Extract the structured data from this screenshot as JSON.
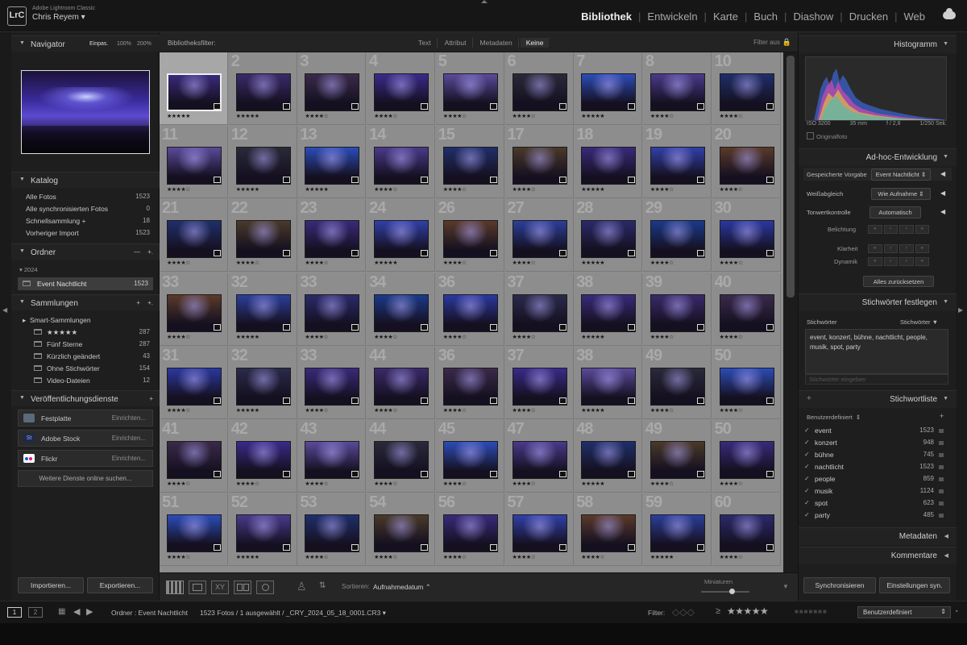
{
  "app": {
    "subtitle": "Adobe Lightroom Classic",
    "user": "Chris Reyem",
    "logo": "LrC"
  },
  "modules": [
    "Bibliothek",
    "Entwickeln",
    "Karte",
    "Buch",
    "Diashow",
    "Drucken",
    "Web"
  ],
  "active_module": "Bibliothek",
  "navigator": {
    "title": "Navigator",
    "zoom": [
      "Einpas.",
      "100%",
      "200%"
    ]
  },
  "catalog": {
    "title": "Katalog",
    "items": [
      {
        "label": "Alle Fotos",
        "count": "1523"
      },
      {
        "label": "Alle synchronisierten Fotos",
        "count": "0"
      },
      {
        "label": "Schnellsammlung +",
        "count": "18"
      },
      {
        "label": "Vorheriger Import",
        "count": "1523"
      }
    ]
  },
  "folders": {
    "title": "Ordner",
    "year": "2024",
    "folder": {
      "label": "Event Nachtlicht",
      "count": "1523"
    }
  },
  "collections": {
    "title": "Sammlungen",
    "group": "Smart-Sammlungen",
    "items": [
      {
        "label": "★★★★★",
        "count": "287"
      },
      {
        "label": "Fünf Sterne",
        "count": "287"
      },
      {
        "label": "Kürzlich geändert",
        "count": "43"
      },
      {
        "label": "Ohne Stichwörter",
        "count": "154"
      },
      {
        "label": "Video-Dateien",
        "count": "12"
      }
    ]
  },
  "publish": {
    "title": "Veröffentlichungsdienste",
    "services": [
      {
        "label": "Festplatte",
        "action": "Einrichten...",
        "color": "#5a6a7a"
      },
      {
        "label": "Adobe Stock",
        "action": "Einrichten...",
        "color": "#1e2a4a"
      },
      {
        "label": "Flickr",
        "action": "Einrichten...",
        "color": "#ffffff"
      }
    ],
    "more": "Weitere Dienste online suchen..."
  },
  "left_buttons": {
    "import": "Importieren...",
    "export": "Exportieren..."
  },
  "filterbar": {
    "label": "Bibliotheksfilter:",
    "tabs": [
      "Text",
      "Attribut",
      "Metadaten",
      "Keine"
    ],
    "active": "Keine",
    "filter_off": "Filter aus"
  },
  "grid": {
    "numbers": [
      "1",
      "2",
      "3",
      "4",
      "5",
      "6",
      "7",
      "8",
      "10",
      "11",
      "12",
      "13",
      "14",
      "15",
      "17",
      "18",
      "19",
      "20",
      "21",
      "22",
      "23",
      "24",
      "26",
      "27",
      "28",
      "29",
      "30",
      "33",
      "32",
      "33",
      "34",
      "36",
      "37",
      "38",
      "39",
      "40",
      "31",
      "32",
      "33",
      "44",
      "36",
      "37",
      "38",
      "49",
      "50",
      "41",
      "42",
      "43",
      "44",
      "45",
      "47",
      "48",
      "49",
      "50",
      "51",
      "52",
      "53",
      "54",
      "56",
      "57",
      "58",
      "59",
      "60"
    ],
    "ratings": [
      "★★★★★",
      "★★★★★",
      "★★★★☆",
      "★★★★☆",
      "★★★★☆",
      "★★★★☆",
      "★★★★★",
      "★★★★☆",
      "★★★★☆",
      "★★★★☆",
      "★★★★★",
      "★★★★★",
      "★★★★☆",
      "★★★★☆",
      "★★★★☆",
      "★★★★★",
      "★★★★☆",
      "★★★★☆",
      "★★★★☆",
      "★★★★☆",
      "★★★★☆",
      "★★★★★",
      "★★★★☆",
      "★★★★☆",
      "★★★★★",
      "★★★★☆",
      "★★★★☆",
      "★★★★☆",
      "★★★★★",
      "★★★★☆",
      "★★★★☆",
      "★★★★☆",
      "★★★★☆",
      "★★★★★",
      "★★★★☆",
      "★★★★☆",
      "★★★★☆",
      "★★★★★",
      "★★★★☆",
      "★★★★☆",
      "★★★★☆",
      "★★★★☆",
      "★★★★★",
      "★★★★☆",
      "★★★★☆",
      "★★★★☆",
      "★★★★☆",
      "★★★★☆",
      "★★★★☆",
      "★★★★☆",
      "★★★★☆",
      "★★★★★",
      "★★★★☆",
      "★★★★☆",
      "★★★★☆",
      "★★★★★",
      "★★★★☆",
      "★★★★☆",
      "★★★★☆",
      "★★★★☆",
      "★★★★☆",
      "★★★★★",
      "★★★★☆"
    ],
    "photo_colors": [
      "#3a2a7a",
      "#2b3f9a",
      "#1f2f6a",
      "#3a2a8a",
      "#2a38a0",
      "#3040a8",
      "#2b4cb8",
      "#3a2a6a",
      "#2a2a6a",
      "#4a3a2a",
      "#5a4a9a",
      "#2a2a4a",
      "#5a3a2a",
      "#4a3a8a",
      "#3a2a4a",
      "#1a3a8a",
      "#3a2a7a",
      "#2a2a3a"
    ],
    "selected_index": 0
  },
  "toolbar": {
    "sort_label": "Sortieren:",
    "sort_value": "Aufnahmedatum",
    "thumb_label": "Miniaturen"
  },
  "histogram": {
    "title": "Histogramm",
    "iso": "ISO 3200",
    "focal": "35 mm",
    "aperture": "f / 2,8",
    "shutter": "1/250 Sek.",
    "original": "Originalfoto"
  },
  "quick_develop": {
    "title": "Ad-hoc-Entwicklung",
    "preset_label": "Gespeicherte Vorgabe",
    "preset_value": "Event Nachtlicht",
    "wb_label": "Weißabgleich",
    "wb_value": "Wie Aufnahme",
    "tone_label": "Tonwertkontrolle",
    "tone_value": "Automatisch",
    "exposure": "Belichtung",
    "clarity": "Klarheit",
    "vibrance": "Dynamik",
    "reset": "Alles zurücksetzen"
  },
  "keywording": {
    "title": "Stichwörter festlegen",
    "label": "Stichwörter",
    "dropdown": "Stichwörter",
    "tags": "event, konzert, bühne, nachtlicht, people, musik, spot, party",
    "placeholder": "Stichwörter eingeben"
  },
  "keyword_list": {
    "title": "Stichwortliste",
    "filter": "Benutzerdefiniert",
    "items": [
      {
        "label": "event",
        "count": "1523"
      },
      {
        "label": "konzert",
        "count": "948"
      },
      {
        "label": "bühne",
        "count": "745"
      },
      {
        "label": "nachtlicht",
        "count": "1523"
      },
      {
        "label": "people",
        "count": "859"
      },
      {
        "label": "musik",
        "count": "1124"
      },
      {
        "label": "spot",
        "count": "623"
      },
      {
        "label": "party",
        "count": "485"
      }
    ]
  },
  "metadata": {
    "title": "Metadaten"
  },
  "comments": {
    "title": "Kommentare"
  },
  "right_buttons": {
    "sync": "Synchronisieren",
    "sync_settings": "Einstellungen syn."
  },
  "bottombar": {
    "page1": "1",
    "page2": "2",
    "source": "Ordner : Event Nachtlicht",
    "info": "1523 Fotos / 1 ausgewählt / _CRY_2024_05_18_0001.CR3",
    "filter_label": "Filter:",
    "filter_value": "Benutzerdefiniert"
  }
}
